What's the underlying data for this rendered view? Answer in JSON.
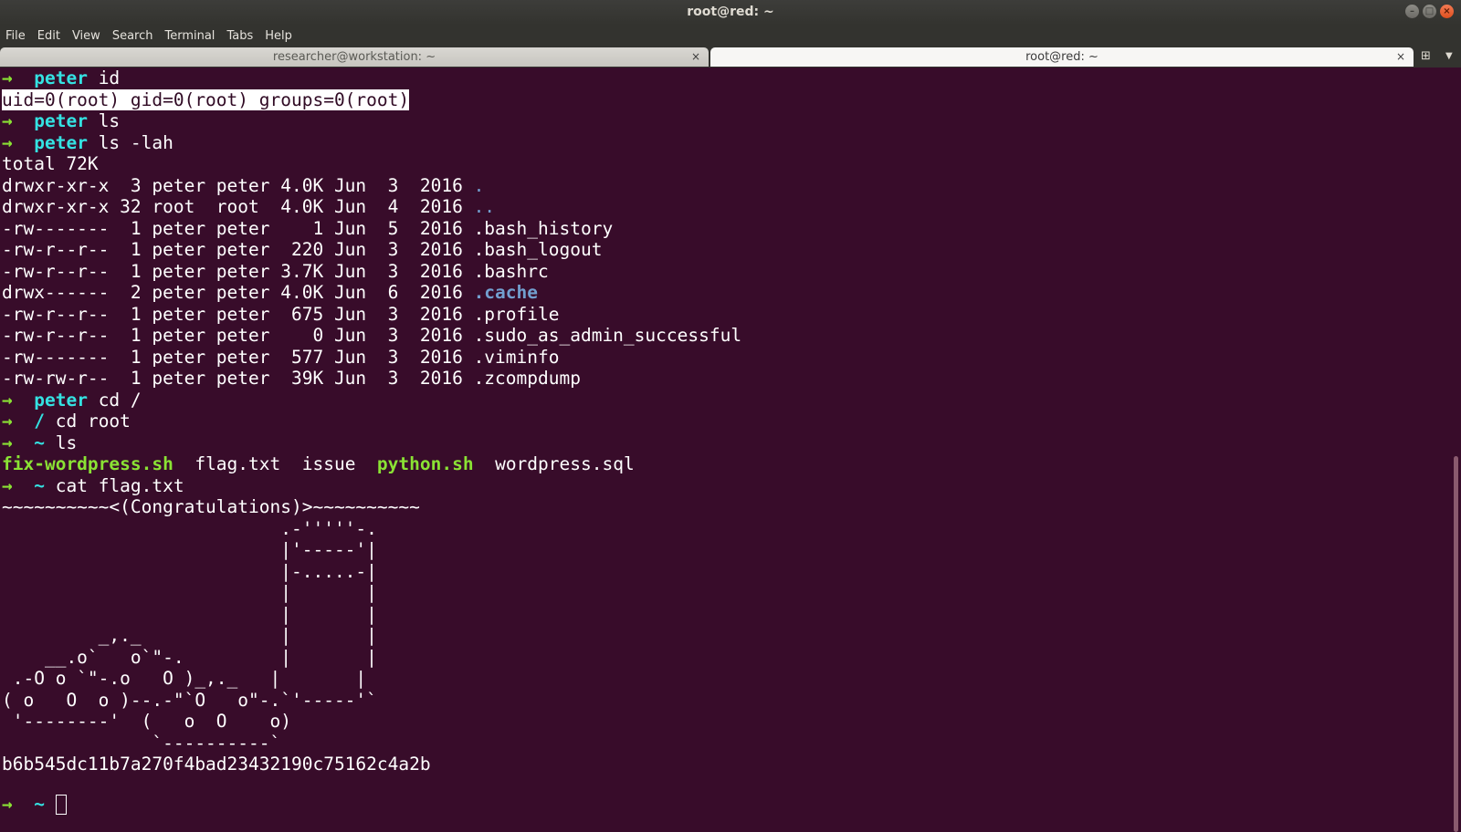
{
  "window": {
    "title": "root@red: ~"
  },
  "menu": [
    "File",
    "Edit",
    "View",
    "Search",
    "Terminal",
    "Tabs",
    "Help"
  ],
  "tabs": [
    {
      "label": "researcher@workstation: ~",
      "close": "×"
    },
    {
      "label": "root@red: ~",
      "close": "×"
    }
  ],
  "terminal": {
    "arrow": "→",
    "cmd_id": {
      "cwd": "peter",
      "cmd": "id"
    },
    "id_output": "uid=0(root) gid=0(root) groups=0(root)",
    "cmd_ls": {
      "cwd": "peter",
      "cmd": "ls"
    },
    "cmd_lsl": {
      "cwd": "peter",
      "cmd": "ls -lah"
    },
    "total": "total 72K",
    "listing": [
      {
        "meta": "drwxr-xr-x  3 peter peter 4.0K Jun  3  2016 ",
        "name": "."
      },
      {
        "meta": "drwxr-xr-x 32 root  root  4.0K Jun  4  2016 ",
        "name": ".."
      },
      {
        "meta": "-rw-------  1 peter peter    1 Jun  5  2016 ",
        "name": ".bash_history"
      },
      {
        "meta": "-rw-r--r--  1 peter peter  220 Jun  3  2016 ",
        "name": ".bash_logout"
      },
      {
        "meta": "-rw-r--r--  1 peter peter 3.7K Jun  3  2016 ",
        "name": ".bashrc"
      },
      {
        "meta": "drwx------  2 peter peter 4.0K Jun  6  2016 ",
        "name": ".cache"
      },
      {
        "meta": "-rw-r--r--  1 peter peter  675 Jun  3  2016 ",
        "name": ".profile"
      },
      {
        "meta": "-rw-r--r--  1 peter peter    0 Jun  3  2016 ",
        "name": ".sudo_as_admin_successful"
      },
      {
        "meta": "-rw-------  1 peter peter  577 Jun  3  2016 ",
        "name": ".viminfo"
      },
      {
        "meta": "-rw-rw-r--  1 peter peter  39K Jun  3  2016 ",
        "name": ".zcompdump"
      }
    ],
    "cmd_cd": {
      "cwd": "peter",
      "cmd": "cd /"
    },
    "cmd_cdroot": {
      "cwd": "/",
      "cmd": "cd root"
    },
    "cmd_ls2": {
      "cwd": "~",
      "cmd": "ls"
    },
    "ls_files": [
      "fix-wordpress.sh",
      "flag.txt",
      "issue",
      "python.sh",
      "wordpress.sql"
    ],
    "cmd_cat": {
      "cwd": "~",
      "cmd": "cat flag.txt"
    },
    "flag_art": [
      "~~~~~~~~~~<(Congratulations)>~~~~~~~~~~",
      "                          .-'''''-.",
      "                          |'-----'|",
      "                          |-.....-|",
      "                          |       |",
      "                          |       |",
      "         _,._             |       |",
      "    __.o`   o`\"-.         |       |",
      " .-O o `\"-.o   O )_,._   |       |",
      "( o   O  o )--.-\"`O   o\"-.`'-----'`",
      " '--------'  (   o  O    o)",
      "              `----------`"
    ],
    "flag_hash": "b6b545dc11b7a270f4bad23432190c75162c4a2b",
    "final_prompt": {
      "cwd": "~"
    }
  }
}
